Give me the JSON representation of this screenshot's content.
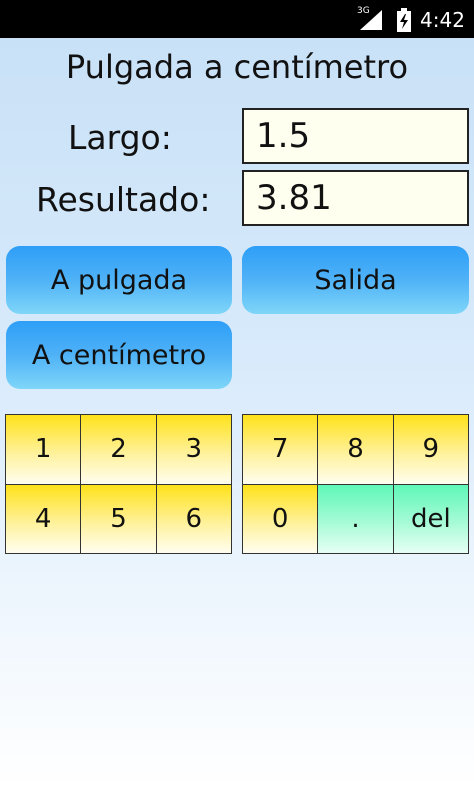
{
  "status_bar": {
    "network": "3G",
    "time": "4:42"
  },
  "title": "Pulgada a centímetro",
  "form": {
    "length_label": "Largo:",
    "length_value": "1.5",
    "result_label": "Resultado:",
    "result_value": "3.81"
  },
  "buttons": {
    "to_inch": "A pulgada",
    "exit": "Salida",
    "to_cm": "A centímetro"
  },
  "keypad": {
    "left": [
      "1",
      "2",
      "3",
      "4",
      "5",
      "6"
    ],
    "right": [
      "7",
      "8",
      "9",
      "0",
      ".",
      "del"
    ]
  },
  "colors": {
    "key_yellow": "#ffe21a",
    "key_green": "#5ff7b8",
    "button_blue": "#2d9ef7"
  }
}
